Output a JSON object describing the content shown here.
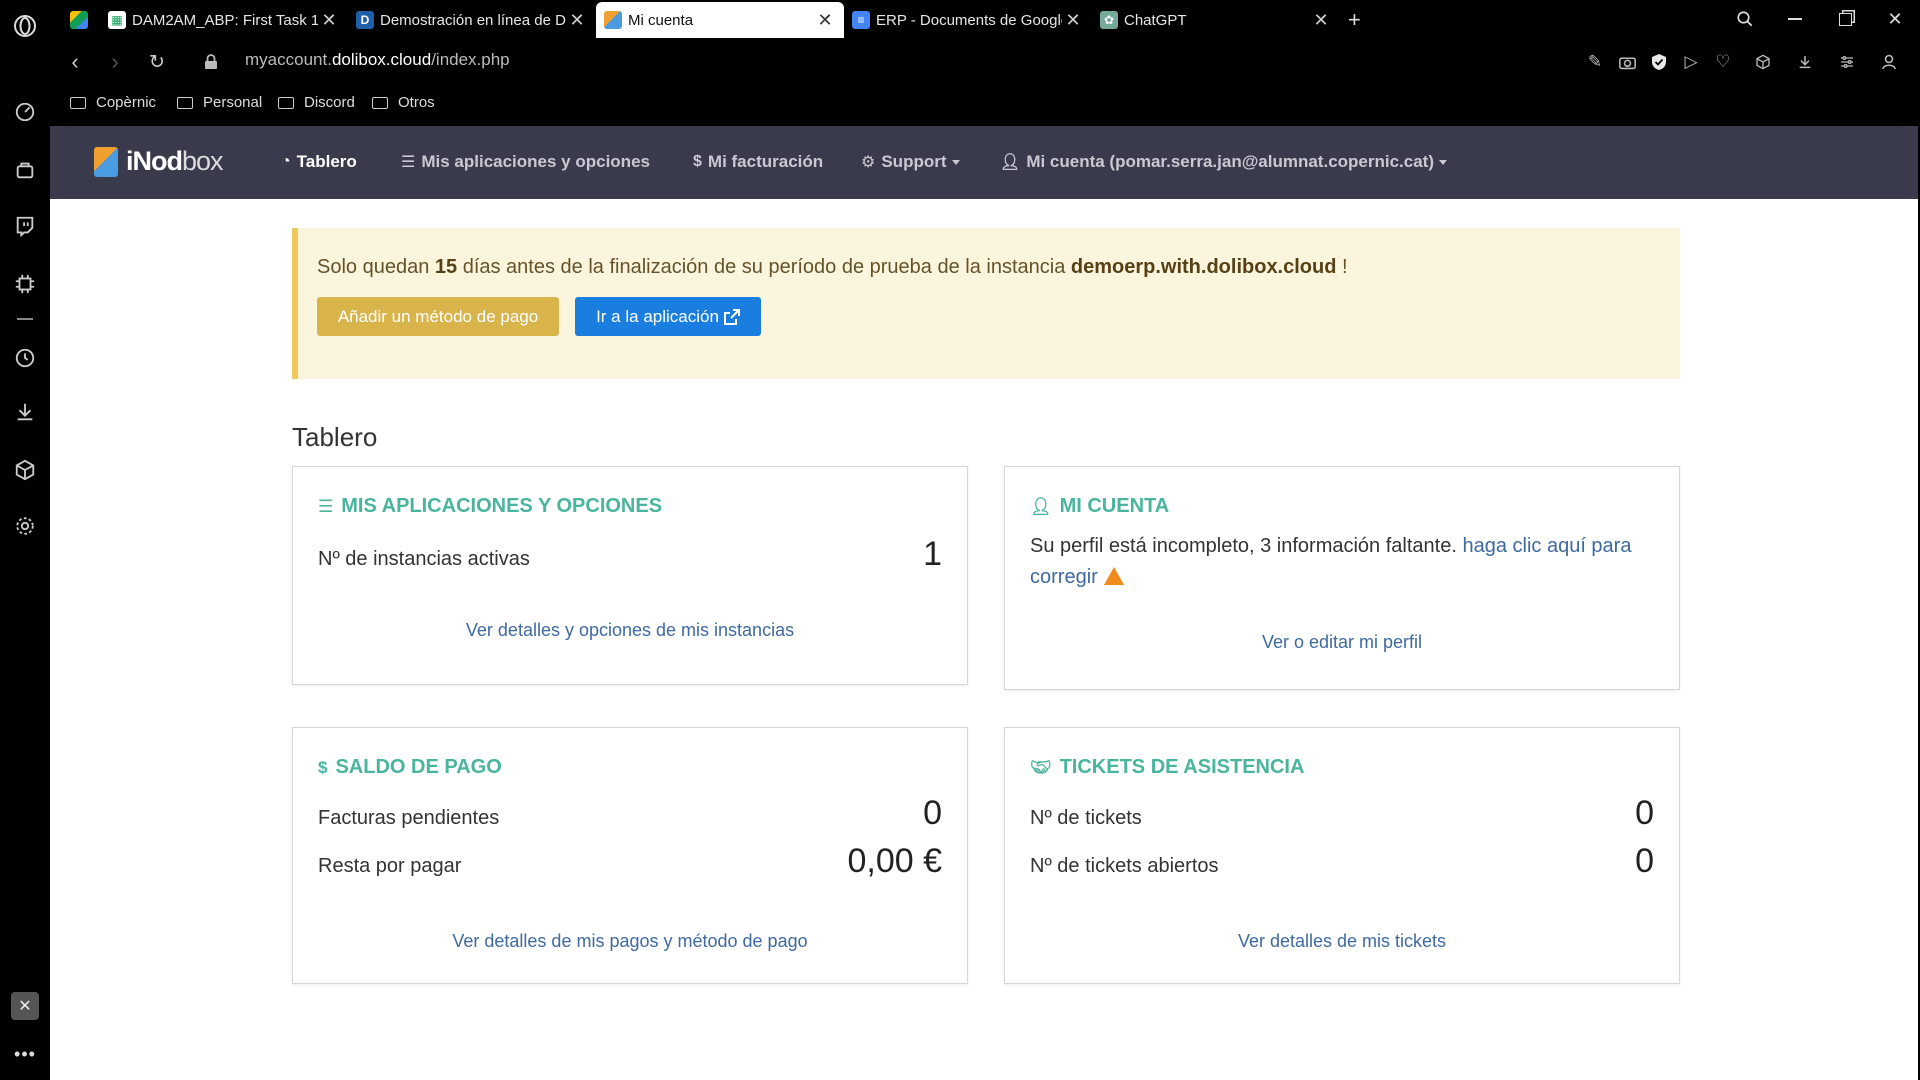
{
  "browser": {
    "tabs": [
      {
        "title": "DAM2AM_ABP: First Task 1",
        "icon": "google-classroom-icon",
        "active": false
      },
      {
        "title": "Demostración en línea de D",
        "icon": "dolibarr-icon",
        "active": false
      },
      {
        "title": "Mi cuenta",
        "icon": "dolibox-icon",
        "active": true
      },
      {
        "title": "ERP - Documents de Google",
        "icon": "google-docs-icon",
        "active": false
      },
      {
        "title": "ChatGPT",
        "icon": "chatgpt-icon",
        "active": false
      }
    ],
    "new_tab_glyph": "+",
    "url_prefix": "myaccount.",
    "url_domain": "dolibox.cloud",
    "url_path": "/index.php",
    "bookmarks": [
      "Copèrnic",
      "Personal",
      "Discord",
      "Otros"
    ]
  },
  "site": {
    "logo_part1": "iNod",
    "logo_part2": "box",
    "nav": [
      {
        "label": "Tablero",
        "icon": "dashboard-icon",
        "active": true
      },
      {
        "label": "Mis aplicaciones y opciones",
        "icon": "server-icon",
        "active": false
      },
      {
        "label": "Mi facturación",
        "icon": "dollar-icon",
        "active": false
      },
      {
        "label": "Support",
        "icon": "gear-icon",
        "active": false,
        "dropdown": true
      },
      {
        "label": "Mi cuenta (pomar.serra.jan@alumnat.copernic.cat)",
        "icon": "user-icon",
        "active": false,
        "dropdown": true
      }
    ]
  },
  "alert": {
    "text_before": "Solo quedan ",
    "days": "15",
    "text_middle": " días antes de la finalización de su período de prueba de la instancia ",
    "instance": "demoerp.with.dolibox.cloud",
    "text_after": " !",
    "btn_payment": "Añadir un método de pago",
    "btn_go": "Ir a la aplicación"
  },
  "dashboard": {
    "heading": "Tablero",
    "apps": {
      "title": "MIS APLICACIONES Y OPCIONES",
      "active_label": "Nº de instancias activas",
      "active_value": "1",
      "link": "Ver detalles y opciones de mis instancias"
    },
    "account": {
      "title": "MI CUENTA",
      "text": "Su perfil está incompleto, 3 información faltante. ",
      "fix_link": "haga clic aquí para corregir",
      "link": "Ver o editar mi perfil"
    },
    "payments": {
      "title": "SALDO DE PAGO",
      "pending_label": "Facturas pendientes",
      "pending_value": "0",
      "remaining_label": "Resta por pagar",
      "remaining_value": "0,00 €",
      "link": "Ver detalles de mis pagos y método de pago"
    },
    "tickets": {
      "title": "TICKETS DE ASISTENCIA",
      "count_label": "Nº de tickets",
      "count_value": "0",
      "open_label": "Nº de tickets abiertos",
      "open_value": "0",
      "link": "Ver detalles de mis tickets"
    }
  },
  "colors": {
    "navbar": "#393a4b",
    "card_title": "#4ab59e",
    "link": "#3e6aa1",
    "alert_bg": "#fcf5dd",
    "btn_warning": "#d9b44a",
    "btn_primary": "#1a7ee0"
  }
}
